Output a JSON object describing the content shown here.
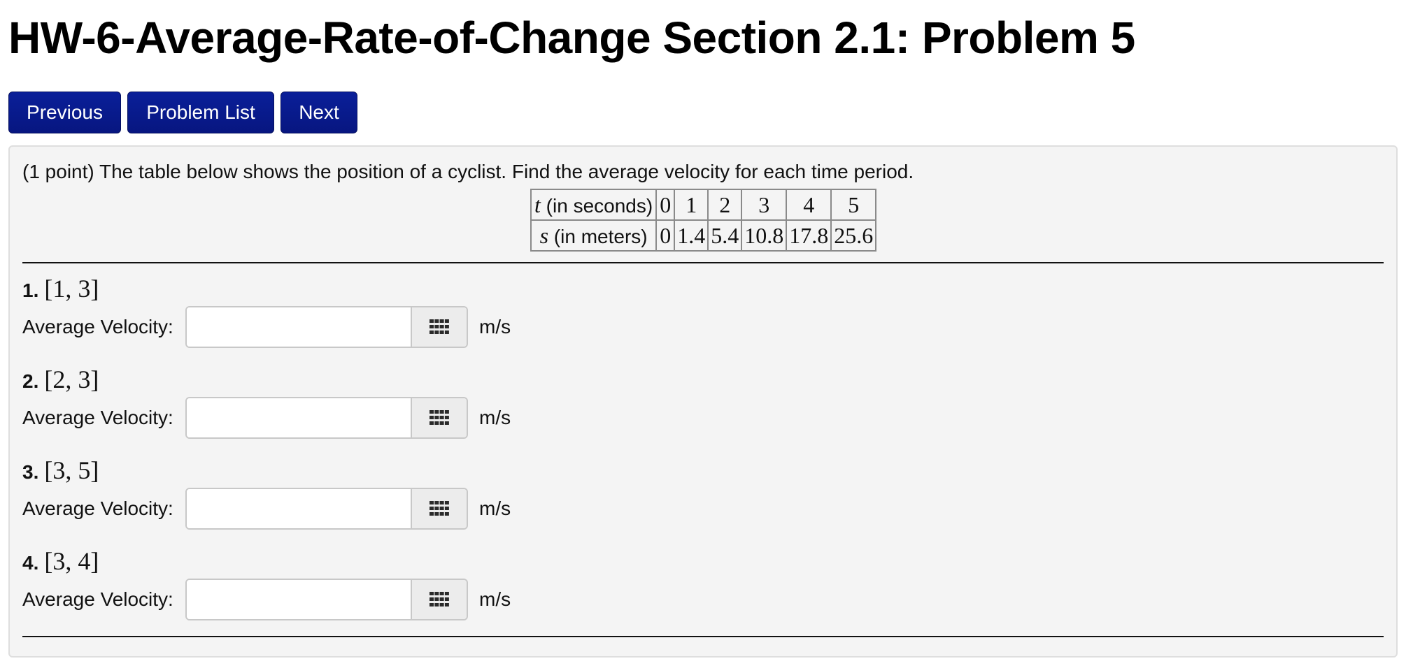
{
  "page_title": "HW-6-Average-Rate-of-Change Section 2.1: Problem 5",
  "nav": {
    "previous": "Previous",
    "problem_list": "Problem List",
    "next": "Next"
  },
  "problem": {
    "intro": "(1 point) The table below shows the position of a cyclist. Find the average velocity for each time period.",
    "table": {
      "t_var": "t",
      "t_unit": " (in seconds)",
      "t_values": [
        "0",
        "1",
        "2",
        "3",
        "4",
        "5"
      ],
      "s_var": "s",
      "s_unit": " (in meters)",
      "s_values": [
        "0",
        "1.4",
        "5.4",
        "10.8",
        "17.8",
        "25.6"
      ]
    },
    "parts": [
      {
        "number": "1.",
        "interval": "[1, 3]",
        "label": "Average Velocity:",
        "value": "",
        "unit": "m/s"
      },
      {
        "number": "2.",
        "interval": "[2, 3]",
        "label": "Average Velocity:",
        "value": "",
        "unit": "m/s"
      },
      {
        "number": "3.",
        "interval": "[3, 5]",
        "label": "Average Velocity:",
        "value": "",
        "unit": "m/s"
      },
      {
        "number": "4.",
        "interval": "[3, 4]",
        "label": "Average Velocity:",
        "value": "",
        "unit": "m/s"
      }
    ],
    "keypad_icon": "keypad-grid-icon"
  }
}
